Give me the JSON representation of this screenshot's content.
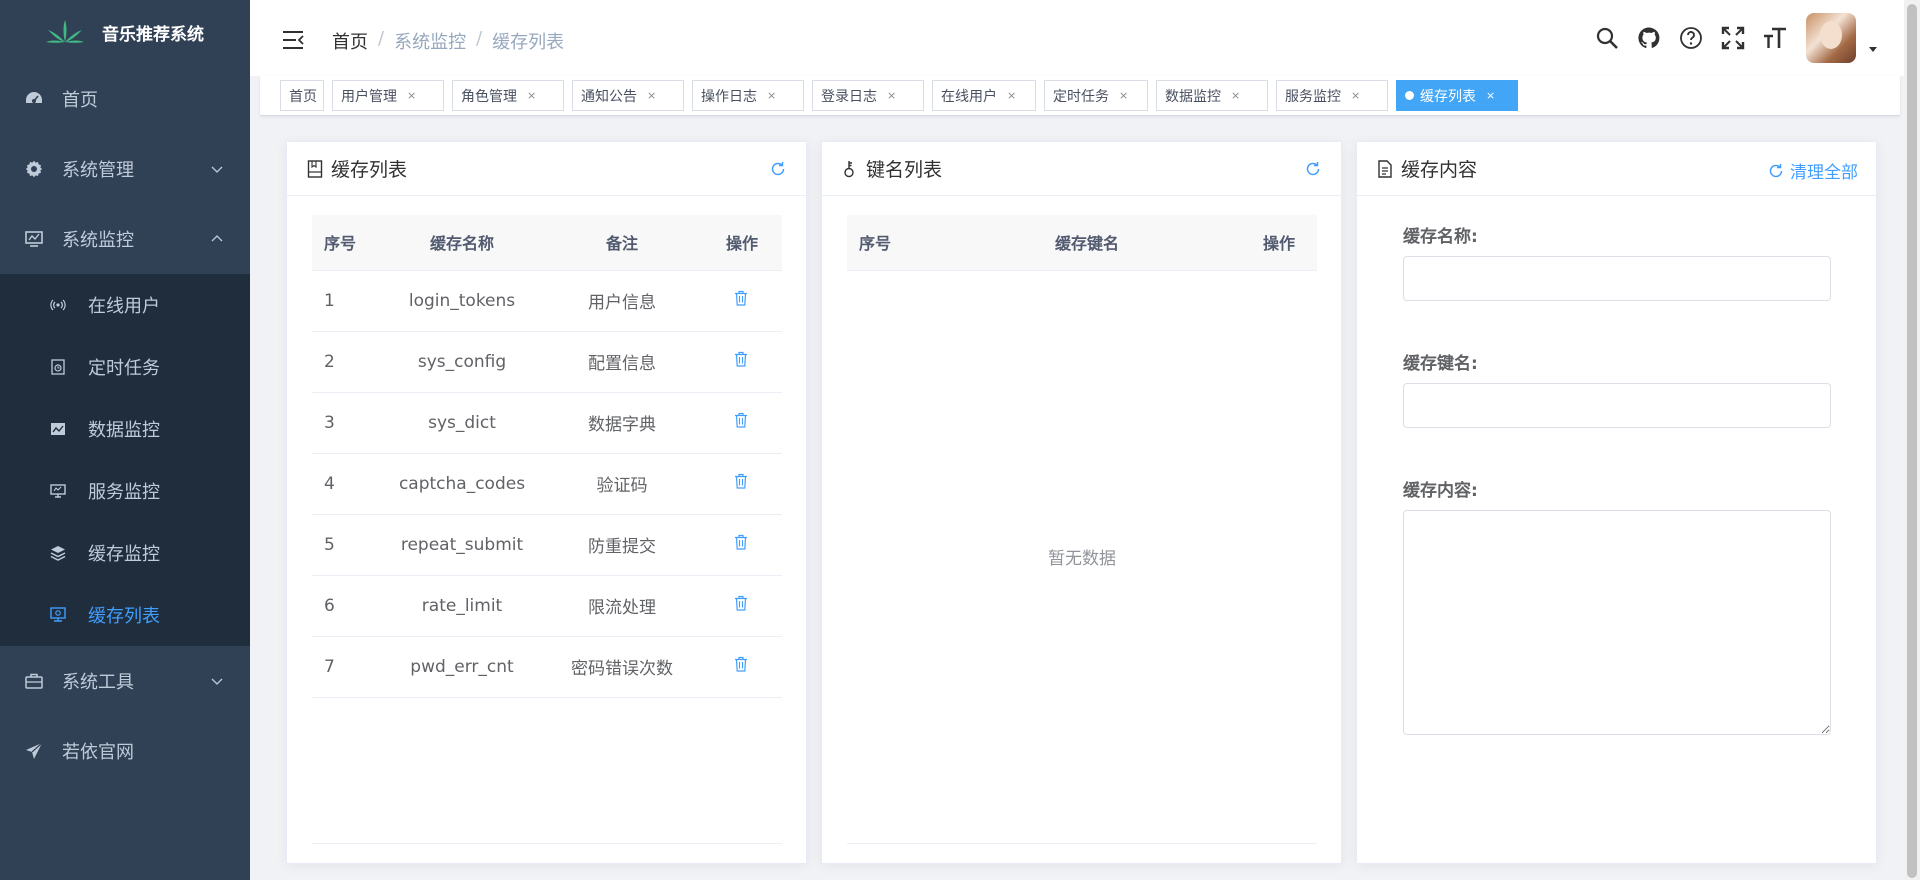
{
  "app": {
    "title": "音乐推荐系统"
  },
  "sidebar": {
    "items": [
      {
        "label": "首页",
        "icon": "dashboard-icon"
      },
      {
        "label": "系统管理",
        "icon": "gear-icon",
        "expandable": true,
        "expanded": false
      },
      {
        "label": "系统监控",
        "icon": "monitor-icon",
        "expandable": true,
        "expanded": true,
        "children": [
          {
            "label": "在线用户",
            "icon": "online-icon"
          },
          {
            "label": "定时任务",
            "icon": "job-icon"
          },
          {
            "label": "数据监控",
            "icon": "druid-icon"
          },
          {
            "label": "服务监控",
            "icon": "server-icon"
          },
          {
            "label": "缓存监控",
            "icon": "redis-icon"
          },
          {
            "label": "缓存列表",
            "icon": "redis-list-icon",
            "active": true
          }
        ]
      },
      {
        "label": "系统工具",
        "icon": "tool-icon",
        "expandable": true,
        "expanded": false
      },
      {
        "label": "若依官网",
        "icon": "guide-icon"
      }
    ]
  },
  "breadcrumb": {
    "items": [
      "首页",
      "系统监控",
      "缓存列表"
    ],
    "separator": "/"
  },
  "header_icons": [
    "search-icon",
    "github-icon",
    "question-icon",
    "fullscreen-icon",
    "font-size-icon"
  ],
  "tags": [
    {
      "label": "首页",
      "closable": false
    },
    {
      "label": "用户管理",
      "closable": true
    },
    {
      "label": "角色管理",
      "closable": true
    },
    {
      "label": "通知公告",
      "closable": true
    },
    {
      "label": "操作日志",
      "closable": true
    },
    {
      "label": "登录日志",
      "closable": true
    },
    {
      "label": "在线用户",
      "closable": true
    },
    {
      "label": "定时任务",
      "closable": true
    },
    {
      "label": "数据监控",
      "closable": true
    },
    {
      "label": "服务监控",
      "closable": true
    },
    {
      "label": "缓存列表",
      "closable": true,
      "active": true
    }
  ],
  "cache_list": {
    "title": "缓存列表",
    "columns": [
      "序号",
      "缓存名称",
      "备注",
      "操作"
    ],
    "rows": [
      {
        "idx": "1",
        "name": "login_tokens",
        "remark": "用户信息"
      },
      {
        "idx": "2",
        "name": "sys_config",
        "remark": "配置信息"
      },
      {
        "idx": "3",
        "name": "sys_dict",
        "remark": "数据字典"
      },
      {
        "idx": "4",
        "name": "captcha_codes",
        "remark": "验证码"
      },
      {
        "idx": "5",
        "name": "repeat_submit",
        "remark": "防重提交"
      },
      {
        "idx": "6",
        "name": "rate_limit",
        "remark": "限流处理"
      },
      {
        "idx": "7",
        "name": "pwd_err_cnt",
        "remark": "密码错误次数"
      }
    ]
  },
  "key_list": {
    "title": "键名列表",
    "columns": [
      "序号",
      "缓存键名",
      "操作"
    ],
    "empty_text": "暂无数据"
  },
  "cache_content": {
    "title": "缓存内容",
    "clear_label": "清理全部",
    "fields": {
      "name_label": "缓存名称:",
      "name_value": "",
      "key_label": "缓存键名:",
      "key_value": "",
      "content_label": "缓存内容:",
      "content_value": ""
    }
  },
  "colors": {
    "sidebar_bg": "#304156",
    "submenu_bg": "#1f2d3d",
    "active": "#409eff",
    "tag_active": "#42a5f5"
  }
}
